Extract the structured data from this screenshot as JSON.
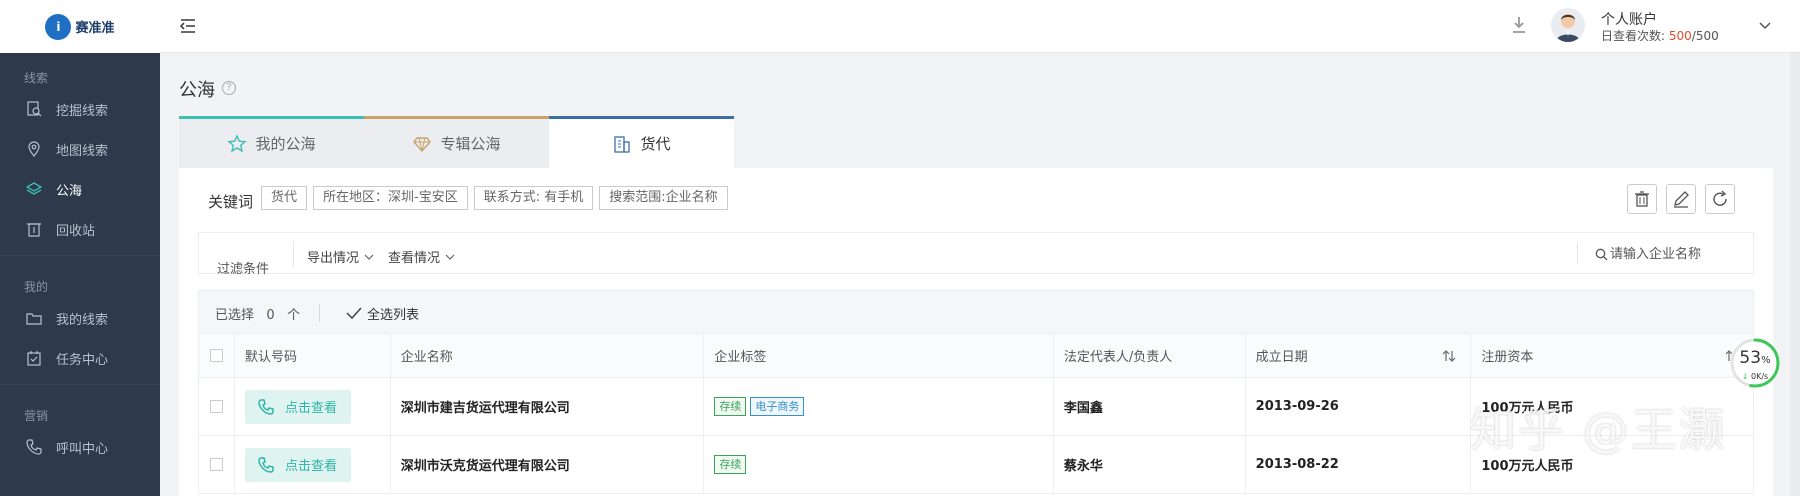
{
  "app": {
    "logo_text": "赛准准",
    "logo_mark": "i"
  },
  "sidebar": {
    "sections": [
      {
        "label": "线索",
        "items": [
          {
            "label": "挖掘线索",
            "icon": "document-search-icon",
            "active": false
          },
          {
            "label": "地图线索",
            "icon": "map-pin-icon",
            "active": false
          },
          {
            "label": "公海",
            "icon": "layers-icon",
            "active": true
          },
          {
            "label": "回收站",
            "icon": "trash-icon",
            "active": false
          }
        ]
      },
      {
        "label": "我的",
        "items": [
          {
            "label": "我的线索",
            "icon": "folder-icon",
            "active": false
          },
          {
            "label": "任务中心",
            "icon": "calendar-check-icon",
            "active": false
          }
        ]
      },
      {
        "label": "营销",
        "items": [
          {
            "label": "呼叫中心",
            "icon": "phone-icon",
            "active": false
          }
        ]
      }
    ]
  },
  "header": {
    "account_name": "个人账户",
    "quota_label": "日查看次数:",
    "quota_used": "500",
    "quota_sep": "/",
    "quota_total": "500"
  },
  "page": {
    "title": "公海",
    "help": "?"
  },
  "tabs": [
    {
      "label": "我的公海",
      "icon": "star-icon",
      "active": false
    },
    {
      "label": "专辑公海",
      "icon": "diamond-icon",
      "active": false
    },
    {
      "label": "货代",
      "icon": "building-icon",
      "active": true
    }
  ],
  "keywords": {
    "label": "关键词",
    "tags": [
      "货代",
      "所在地区：深圳-宝安区",
      "联系方式: 有手机",
      "搜索范围:企业名称"
    ]
  },
  "filters": {
    "label": "过滤条件",
    "export_label": "导出情况",
    "view_label": "查看情况",
    "search_placeholder": "请输入企业名称"
  },
  "selection": {
    "selected_label": "已选择",
    "count": "0",
    "unit": "个",
    "select_all": "全选列表"
  },
  "table": {
    "headers": [
      "默认号码",
      "企业名称",
      "企业标签",
      "法定代表人/负责人",
      "成立日期",
      "注册资本"
    ],
    "rows": [
      {
        "phone_btn": "点击查看",
        "company": "深圳市建吉货运代理有限公司",
        "tags": [
          "存续",
          "电子商务"
        ],
        "legal_rep": "李国鑫",
        "founded": "2013-09-26",
        "capital": "100万元人民币"
      },
      {
        "phone_btn": "点击查看",
        "company": "深圳市沃克货运代理有限公司",
        "tags": [
          "存续"
        ],
        "legal_rep": "蔡永华",
        "founded": "2013-08-22",
        "capital": "100万元人民币"
      }
    ]
  },
  "widget": {
    "percent": "53",
    "percent_unit": "%",
    "speed": "0K/s",
    "progress": 0.53
  },
  "watermark": "知乎 @王灏",
  "colors": {
    "sidebar_bg": "#2e3a4c",
    "accent_teal": "#2fb5a6",
    "quota_red": "#e04b2c",
    "tab_teal": "#3dbfb3",
    "tab_gold": "#c9a36a",
    "tab_blue": "#3b6fa7"
  }
}
